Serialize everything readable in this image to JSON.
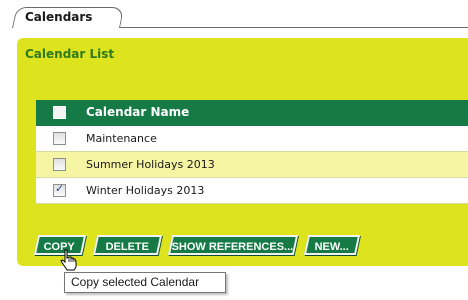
{
  "tab": {
    "label": "Calendars"
  },
  "panel": {
    "title": "Calendar List"
  },
  "table": {
    "header": "Calendar Name",
    "rows": [
      {
        "name": "Maintenance",
        "checked": false
      },
      {
        "name": "Summer Holidays 2013",
        "checked": false
      },
      {
        "name": "Winter Holidays 2013",
        "checked": true
      }
    ]
  },
  "buttons": {
    "copy": "COPY",
    "delete": "DELETE",
    "show_references": "SHOW REFERENCES...",
    "new": "NEW..."
  },
  "tooltip": {
    "text": "Copy selected Calendar"
  },
  "colors": {
    "panel": "#dde31c",
    "header": "#157a45",
    "row_alt": "#f5f5a3",
    "title_green": "#2f7a1a"
  }
}
